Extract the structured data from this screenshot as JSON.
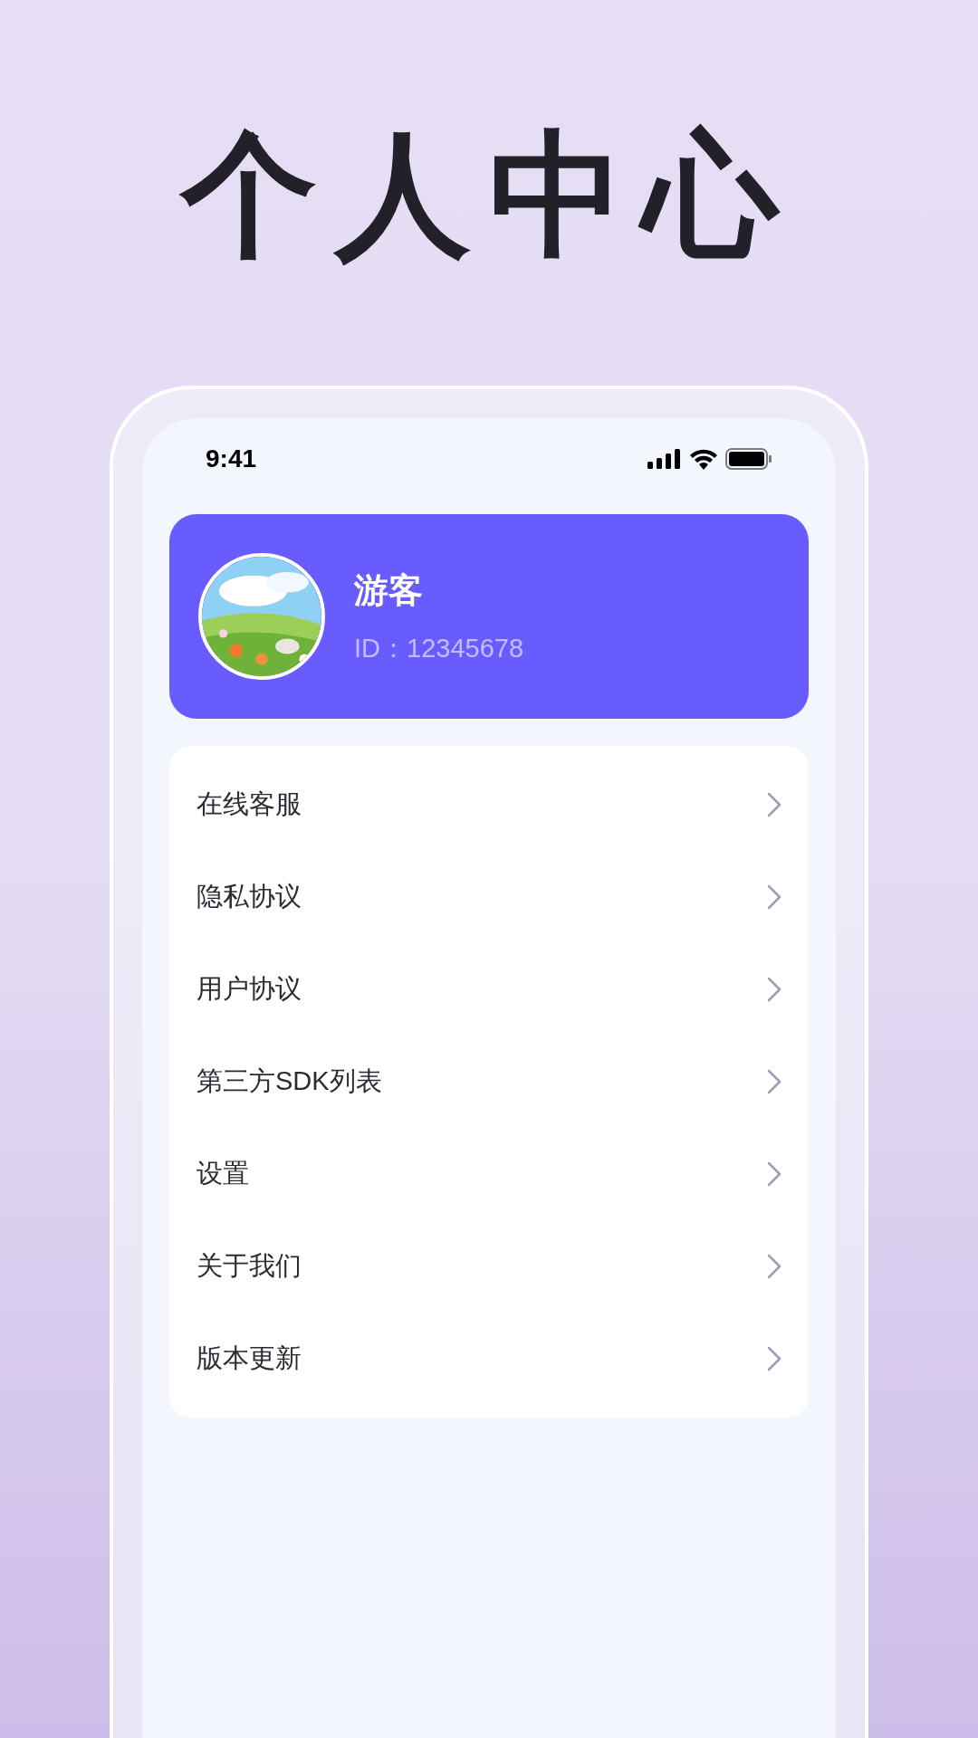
{
  "headline": "个人中心",
  "status_bar": {
    "time": "9:41"
  },
  "profile": {
    "name": "游客",
    "id": "ID：12345678"
  },
  "menu": [
    {
      "label": "在线客服"
    },
    {
      "label": "隐私协议"
    },
    {
      "label": "用户协议"
    },
    {
      "label": "第三方SDK列表"
    },
    {
      "label": "设置"
    },
    {
      "label": "关于我们"
    },
    {
      "label": "版本更新"
    }
  ]
}
